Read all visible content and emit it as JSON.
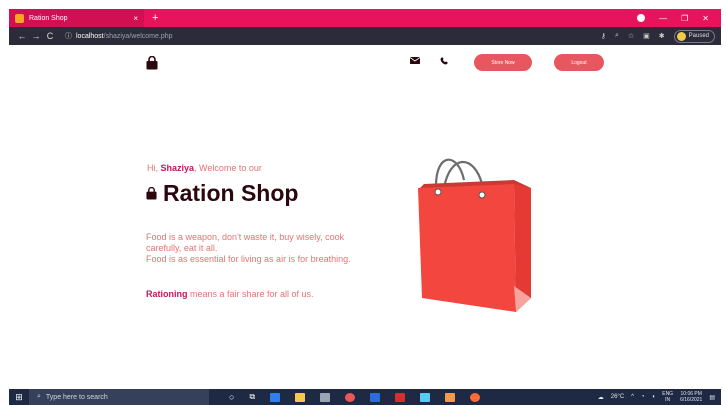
{
  "browser": {
    "tab_title": "Ration Shop",
    "tab_close": "×",
    "new_tab": "+",
    "url_host": "localhost",
    "url_path": "/shaziya/welcome.php",
    "profile_status": "Paused"
  },
  "header": {
    "store_button": "Store Now",
    "logout_button": "Logout"
  },
  "hero": {
    "greeting_prefix": "Hi, ",
    "user_name": "Shaziya",
    "greeting_suffix": ", Welcome to our",
    "title": "Ration Shop",
    "paragraph_line1": "Food is a weapon, don't waste it, buy wisely, cook carefully, eat it all.",
    "paragraph_line2": "Food is as essential for living as air is for breathing.",
    "rationing_word": "Rationing",
    "rationing_rest": " means a fair share for all of us."
  },
  "taskbar": {
    "search_placeholder": "Type here to search",
    "weather": "26°C",
    "lang_line1": "ENG",
    "lang_line2": "IN",
    "time": "10:06 PM",
    "date": "6/16/2021"
  },
  "colors": {
    "tabbar": "#e8135c",
    "accent": "#e8575f",
    "heading": "#2b0710",
    "text": "#e57373",
    "bag": "#f2463f"
  }
}
